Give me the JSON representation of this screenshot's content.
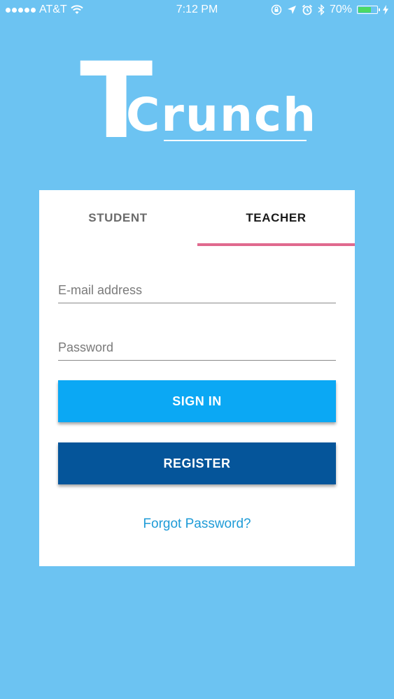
{
  "status_bar": {
    "carrier": "AT&T",
    "time": "7:12 PM",
    "battery_percent": "70%",
    "battery_level": 0.7,
    "icons": [
      "signal-dots-icon",
      "wifi-icon",
      "lock-rotation-icon",
      "location-arrow-icon",
      "alarm-icon",
      "bluetooth-icon",
      "battery-icon",
      "charging-bolt-icon"
    ]
  },
  "logo": {
    "letter_t": "T",
    "crunch": "Crunch"
  },
  "tabs": {
    "student": "STUDENT",
    "teacher": "TEACHER",
    "selected": "TEACHER"
  },
  "form": {
    "email_placeholder": "E-mail address",
    "email_value": "",
    "password_placeholder": "Password",
    "password_value": ""
  },
  "buttons": {
    "sign_in": "SIGN IN",
    "register": "REGISTER"
  },
  "links": {
    "forgot_password": "Forgot Password?"
  },
  "colors": {
    "background": "#6cc3f2",
    "tab_indicator": "#e06a8e",
    "sign_in_button": "#0ba8f4",
    "register_button": "#05559a",
    "link": "#1e9bd7"
  }
}
